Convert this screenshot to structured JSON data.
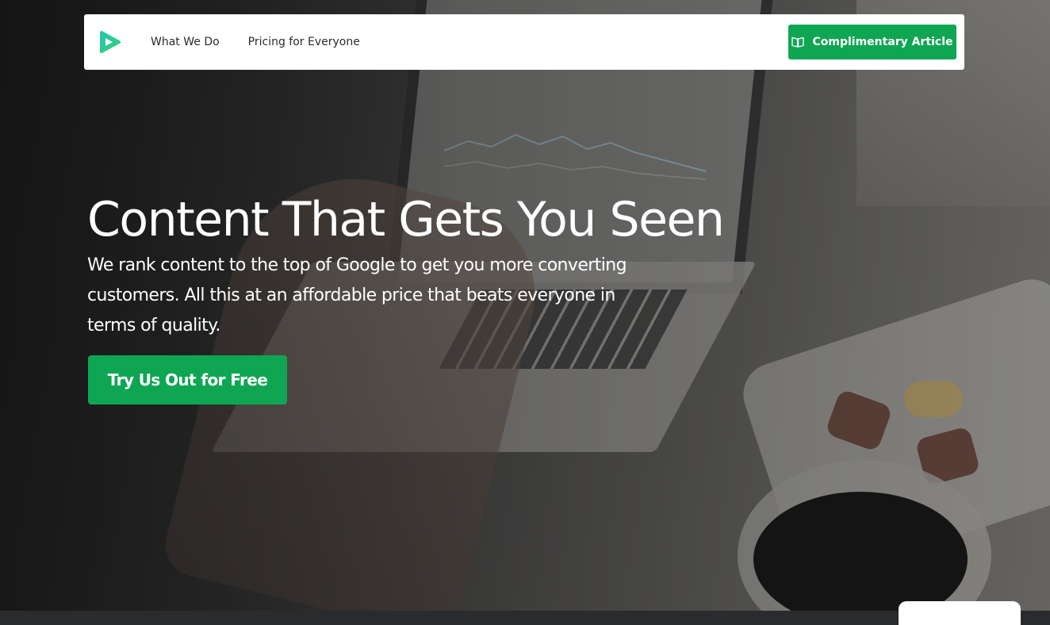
{
  "nav": {
    "logo_icon": "play-triangle-logo-icon",
    "links": [
      "What We Do",
      "Pricing for Everyone"
    ],
    "cta_label": "Complimentary Article",
    "cta_icon": "open-book-icon"
  },
  "hero": {
    "headline": "Content That Gets You Seen",
    "subtext": "We rank content to the top of Google to get you more converting customers. All this at an affordable price that beats everyone in terms of quality.",
    "cta_label": "Try Us Out for Free"
  },
  "colors": {
    "accent": "#0fa653",
    "logo_gradient_start": "#27c7a8",
    "logo_gradient_end": "#33d07a"
  }
}
